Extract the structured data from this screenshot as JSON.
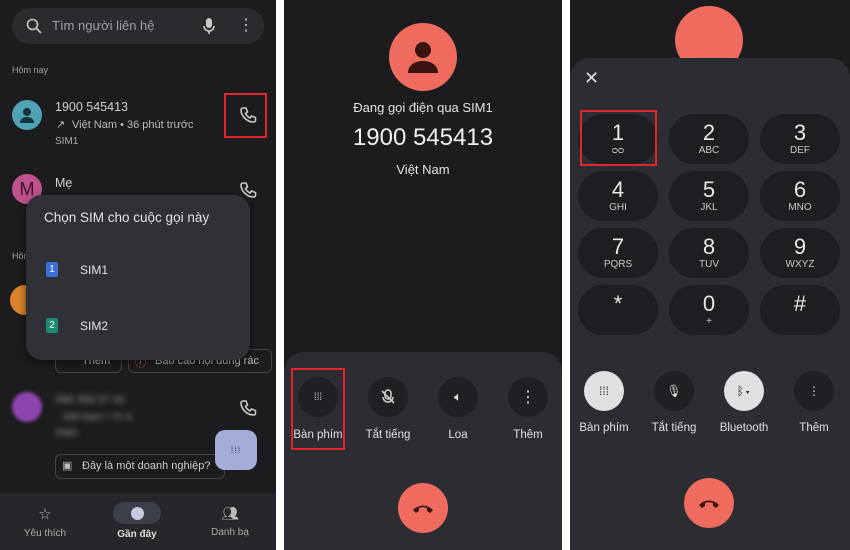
{
  "panel1": {
    "search_placeholder": "Tìm người liên hệ",
    "section_today": "Hôm nay",
    "section_other": "Hôm",
    "calls": [
      {
        "name": "1900 545413",
        "detail": "Việt Nam • 36 phút trước",
        "sim": "SIM1",
        "avatar_color": "#4fa3b4"
      },
      {
        "name": "Mẹ",
        "avatar_letter": "M",
        "avatar_color": "#c0528f"
      },
      {
        "avatar_color": "#d9822b"
      },
      {
        "name": "096 358 07 42",
        "detail": "Việt Nam • Th 6",
        "sim": "SIM1",
        "avatar_color": "#8e44ad"
      }
    ],
    "actions": {
      "add": "Thêm",
      "report_spam": "Báo cáo nội dung rác",
      "business": "Đây là một doanh nghiệp?"
    },
    "sim_dialog": {
      "title": "Chọn SIM cho cuộc gọi này",
      "options": [
        {
          "badge": "1",
          "label": "SIM1",
          "color": "#3b6fd8"
        },
        {
          "badge": "2",
          "label": "SIM2",
          "color": "#1e8a6e"
        }
      ]
    },
    "nav": [
      {
        "label": "Yêu thích",
        "icon": "star-icon"
      },
      {
        "label": "Gần đây",
        "icon": "clock-icon",
        "active": true
      },
      {
        "label": "Danh bạ",
        "icon": "contacts-icon"
      }
    ]
  },
  "panel2": {
    "status": "Đang gọi điện qua SIM1",
    "number": "1900 545413",
    "location": "Việt Nam",
    "controls": [
      {
        "label": "Bàn phím",
        "icon": "dialpad-icon"
      },
      {
        "label": "Tắt tiếng",
        "icon": "mic-off-icon"
      },
      {
        "label": "Loa",
        "icon": "speaker-icon"
      },
      {
        "label": "Thêm",
        "icon": "more-icon"
      }
    ]
  },
  "panel3": {
    "keys": [
      {
        "d": "1",
        "l": "voicemail"
      },
      {
        "d": "2",
        "l": "ABC"
      },
      {
        "d": "3",
        "l": "DEF"
      },
      {
        "d": "4",
        "l": "GHI"
      },
      {
        "d": "5",
        "l": "JKL"
      },
      {
        "d": "6",
        "l": "MNO"
      },
      {
        "d": "7",
        "l": "PQRS"
      },
      {
        "d": "8",
        "l": "TUV"
      },
      {
        "d": "9",
        "l": "WXYZ"
      },
      {
        "d": "*",
        "l": ""
      },
      {
        "d": "0",
        "l": "+"
      },
      {
        "d": "#",
        "l": ""
      }
    ],
    "controls": [
      {
        "label": "Bàn phím",
        "icon": "dialpad-icon"
      },
      {
        "label": "Tắt tiếng",
        "icon": "mic-off-icon"
      },
      {
        "label": "Bluetooth",
        "icon": "bluetooth-icon"
      },
      {
        "label": "Thêm",
        "icon": "more-icon"
      }
    ]
  },
  "colors": {
    "accent_avatar": "#ee6b5e",
    "end_call": "#ee6b5e",
    "highlight": "#e0262b"
  }
}
